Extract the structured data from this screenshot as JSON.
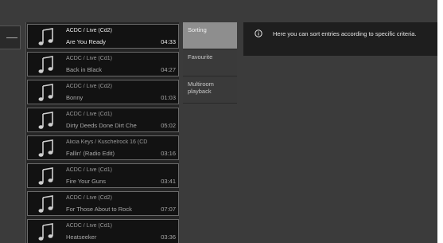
{
  "tracks": [
    {
      "artist": "ACDC / Live (Cd2)",
      "title": "Are You Ready",
      "time": "04:33",
      "selected": true
    },
    {
      "artist": "ACDC / Live (Cd1)",
      "title": "Back in Black",
      "time": "04:27",
      "selected": false
    },
    {
      "artist": "ACDC / Live (Cd2)",
      "title": "Bonny",
      "time": "01:03",
      "selected": false
    },
    {
      "artist": "ACDC / Live (Cd1)",
      "title": "Dirty Deeds Done Dirt Che",
      "time": "05:02",
      "selected": false
    },
    {
      "artist": "Alicia Keys / Kuschelrock 16 (CD",
      "title": "Fallin' (Radio Edit)",
      "time": "03:16",
      "selected": false
    },
    {
      "artist": "ACDC / Live (Cd1)",
      "title": "Fire Your Guns",
      "time": "03:41",
      "selected": false
    },
    {
      "artist": "ACDC / Live (Cd2)",
      "title": "For Those About to Rock",
      "time": "07:07",
      "selected": false
    },
    {
      "artist": "ACDC / Live (Cd1)",
      "title": "Heatseeker",
      "time": "03:36",
      "selected": false
    }
  ],
  "menu": {
    "items": [
      {
        "label": "Sorting",
        "selected": true
      },
      {
        "label": "Favourite",
        "selected": false
      },
      {
        "label": "Multiroom playback",
        "selected": false
      }
    ]
  },
  "info": {
    "icon": "info-circle-icon",
    "text": "Here you can sort entries according to specific criteria."
  },
  "icons": {
    "track": "music-note-icon"
  }
}
